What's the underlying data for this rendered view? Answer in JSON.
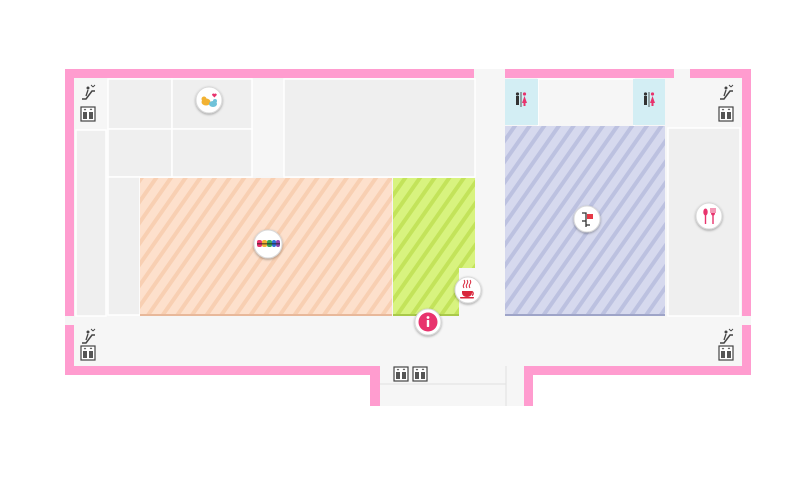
{
  "map": {
    "colors": {
      "wall": "#ff9ccf",
      "floor": "#f6f6f6",
      "room": "#efefef",
      "room_border": "#ffffff",
      "orange_area": "#fde0cc",
      "orange_stripe": "#f8cfb2",
      "green_area": "#d8f37f",
      "green_stripe": "#c3e35a",
      "blue_area": "#d6d9ee",
      "blue_stripe": "#bcc1e0",
      "restroom": "#d3eef4",
      "info_pink": "#e8336d",
      "cafe_red": "#d9263c",
      "dining_red": "#e8336d"
    },
    "pois": [
      {
        "name": "pet-shop-icon",
        "icon": "birds-heart"
      },
      {
        "name": "toy-shop-logo-icon",
        "icon": "colorful-logo"
      },
      {
        "name": "cafe-icon",
        "icon": "coffee-cup"
      },
      {
        "name": "information-icon",
        "icon": "info"
      },
      {
        "name": "store-directory-icon",
        "icon": "flag-sign"
      },
      {
        "name": "restaurant-icon",
        "icon": "fork-spoon"
      }
    ],
    "facilities": [
      {
        "name": "restroom-icon-left",
        "icon": "male-female"
      },
      {
        "name": "restroom-icon-right",
        "icon": "male-female"
      },
      {
        "name": "escalator-icon-nw",
        "icon": "escalator"
      },
      {
        "name": "elevator-icon-nw",
        "icon": "elevator"
      },
      {
        "name": "escalator-icon-ne",
        "icon": "escalator"
      },
      {
        "name": "elevator-icon-ne",
        "icon": "elevator"
      },
      {
        "name": "escalator-icon-sw",
        "icon": "escalator"
      },
      {
        "name": "elevator-icon-sw",
        "icon": "elevator"
      },
      {
        "name": "escalator-icon-se",
        "icon": "escalator"
      },
      {
        "name": "elevator-icon-se",
        "icon": "elevator"
      },
      {
        "name": "elevator-icon-south-1",
        "icon": "elevator"
      },
      {
        "name": "elevator-icon-south-2",
        "icon": "elevator"
      }
    ]
  }
}
